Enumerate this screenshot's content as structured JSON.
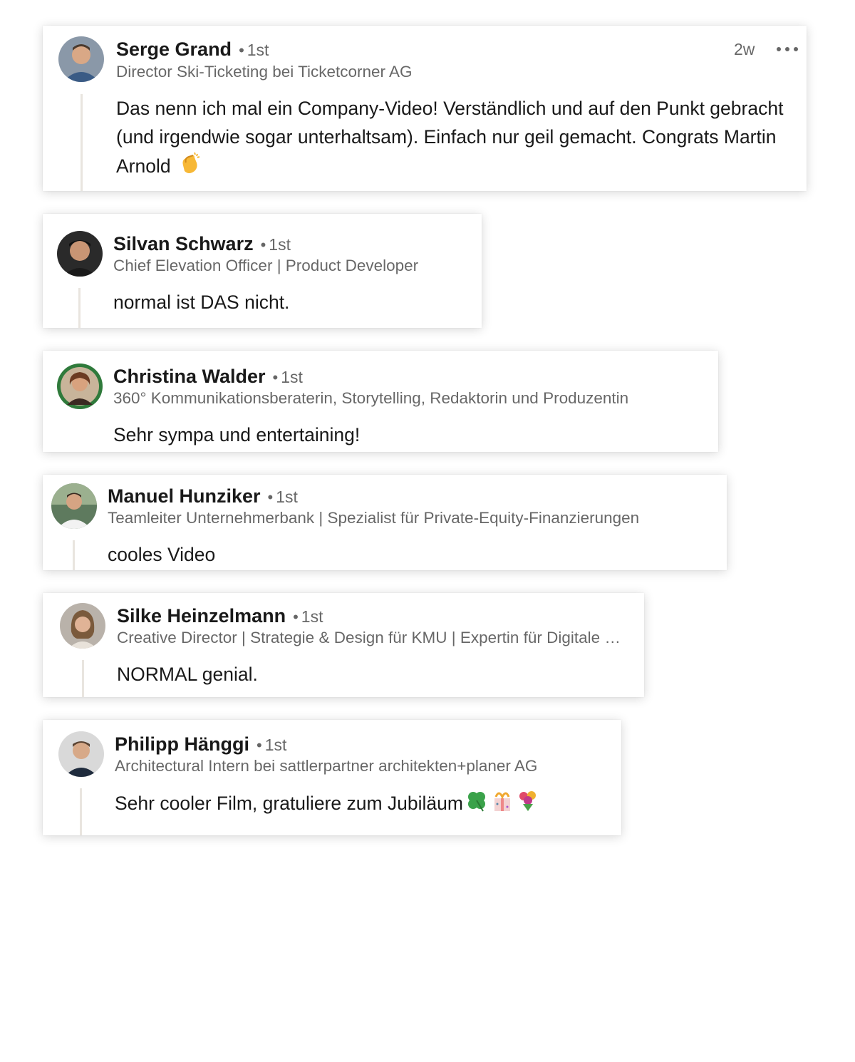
{
  "comments": [
    {
      "name": "Serge Grand",
      "degree": "1st",
      "headline": "Director Ski-Ticketing bei Ticketcorner AG",
      "time": "2w",
      "text": "Das nenn ich mal ein Company-Video! Verständlich und auf den Punkt gebracht (und irgendwie sogar unterhaltsam). Einfach nur geil gemacht. Congrats Martin Arnold",
      "emoji": "clapping-hands"
    },
    {
      "name": "Silvan Schwarz",
      "degree": "1st",
      "headline": "Chief Elevation Officer | Product Developer",
      "text": "normal ist DAS nicht."
    },
    {
      "name": "Christina Walder",
      "degree": "1st",
      "headline": "360° Kommunikationsberaterin, Storytelling, Redaktorin und Produzentin",
      "text": "Sehr sympa und entertaining!"
    },
    {
      "name": "Manuel Hunziker",
      "degree": "1st",
      "headline": "Teamleiter Unternehmerbank | Spezialist für Private-Equity-Finanzierungen",
      "text": "cooles Video"
    },
    {
      "name": "Silke Heinzelmann",
      "degree": "1st",
      "headline": "Creative Director | Strategie & Design für KMU | Expertin für Digitale Markenführung",
      "text": "NORMAL genial."
    },
    {
      "name": "Philipp Hänggi",
      "degree": "1st",
      "headline": "Architectural Intern bei sattlerpartner architekten+planer AG",
      "text": "Sehr cooler Film, gratuliere zum Jubiläum",
      "emojis": [
        "four-leaf-clover",
        "confetti-gift",
        "bouquet"
      ]
    }
  ],
  "colors": {
    "thread_line": "#e9e5df",
    "secondary_text": "rgba(0,0,0,0.6)",
    "primary_text": "rgba(0,0,0,0.9)"
  }
}
